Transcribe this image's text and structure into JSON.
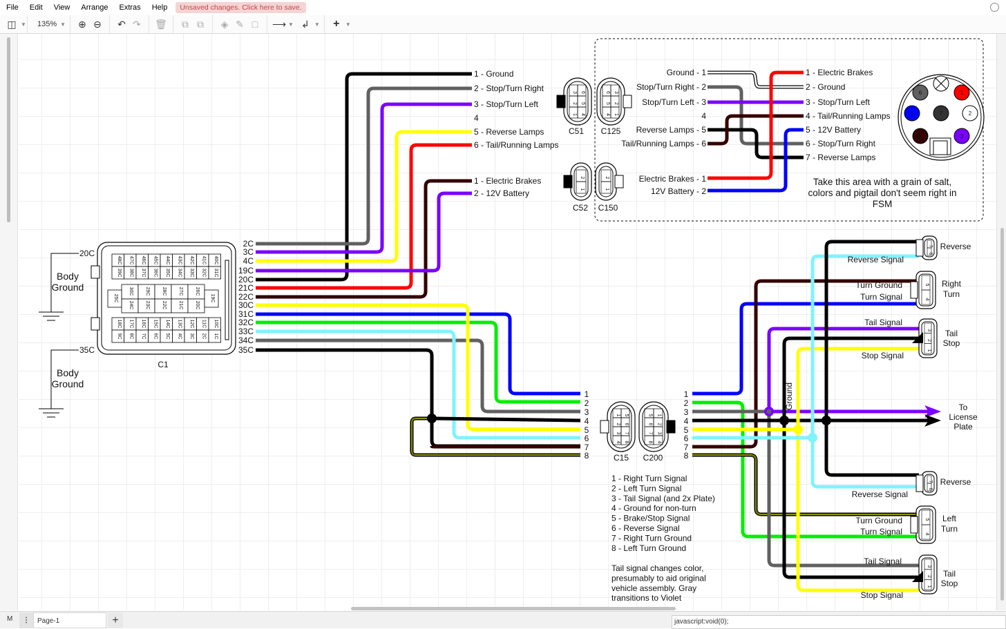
{
  "menu": {
    "items": [
      "File",
      "Edit",
      "View",
      "Arrange",
      "Extras",
      "Help"
    ],
    "unsaved": "Unsaved changes. Click here to save."
  },
  "toolbar": {
    "zoom": "135%"
  },
  "footer": {
    "mode": "M",
    "page_tab": "Page-1",
    "status": "javascript:void(0);"
  },
  "colors": {
    "black": "#000000",
    "gray": "#606060",
    "violet": "#7a00ff",
    "yellow": "#ffff00",
    "red": "#ff0000",
    "brown": "#330000",
    "blue": "#0000ff",
    "green": "#00ee00",
    "cyan": "#7ff3ff"
  },
  "c1": {
    "name": "C1",
    "row1": [
      "48C",
      "47C",
      "46C",
      "45C",
      "44C",
      "43C",
      "42C",
      "41C",
      "40C"
    ],
    "row2": [
      "39C",
      "38C",
      "37C",
      "36C",
      "35C",
      "34C",
      "33C",
      "32C",
      "31C"
    ],
    "mid_left": "25C",
    "mid_right": "19C",
    "row3": [
      "30C",
      "29C",
      "28C",
      "27C",
      "26C"
    ],
    "row4": [
      "24C",
      "23C",
      "22C",
      "21C",
      "20C"
    ],
    "row5": [
      "18C",
      "17C",
      "16C",
      "15C",
      "14C",
      "13C",
      "12C",
      "11C",
      "10C"
    ],
    "row6": [
      "9C",
      "8C",
      "7C",
      "6C",
      "5C",
      "4C",
      "3C",
      "2C",
      "1C"
    ],
    "pins": [
      "2C",
      "3C",
      "4C",
      "19C",
      "20C",
      "21C",
      "22C",
      "30C",
      "31C",
      "32C",
      "33C",
      "34C",
      "35C"
    ],
    "ground_20c": "20C",
    "ground_35c": "35C",
    "body_ground_1": [
      "Body",
      "Ground"
    ],
    "body_ground_2": [
      "Body",
      "Ground"
    ]
  },
  "c51_labels": [
    "1 - Ground",
    "2 - Stop/Turn Right",
    "3 - Stop/Turn Left",
    "4",
    "5 - Reverse Lamps",
    "6 - Tail/Running Lamps"
  ],
  "c52_labels": [
    "1 - Electric Brakes",
    "2 - 12V Battery"
  ],
  "connectors": {
    "c51": "C51",
    "c125": "C125",
    "c52": "C52",
    "c150": "C150",
    "c15": "C15",
    "c200": "C200"
  },
  "c125_left": [
    "Ground - 1",
    "Stop/Turn Right - 2",
    "Stop/Turn Left - 3",
    "4",
    "Reverse Lamps - 5",
    "Tail/Running Lamps - 6"
  ],
  "c150_left": [
    "Electric Brakes - 1",
    "12V Battery - 2"
  ],
  "pigtail_right": [
    "1 - Electric Brakes",
    "2 - Ground",
    "3 - Stop/Turn Left",
    "4 - Tail/Running Lamps",
    "5 - 12V Battery",
    "6 - Stop/Turn Right",
    "7 - Reverse Lamps"
  ],
  "pigtail_note": [
    "Take this area with a grain of salt,",
    "colors and pigtail don't seem right in",
    "FSM"
  ],
  "plug_pins": [
    "1",
    "2",
    "3",
    "4",
    "5",
    "6",
    "7"
  ],
  "c15_left_nums": [
    "1",
    "2",
    "3",
    "4",
    "5",
    "6",
    "7",
    "8"
  ],
  "c200_right_nums": [
    "1",
    "2",
    "3",
    "4",
    "5",
    "6",
    "7",
    "8"
  ],
  "legend": [
    "1 - Right Turn Signal",
    "2 - Left Turn Signal",
    "3 - Tail Signal (and 2x Plate)",
    "4 - Ground for non-turn",
    "5 - Brake/Stop Signal",
    "6 - Reverse Signal",
    "7 - Right Turn Ground",
    "8 - Left Turn Ground"
  ],
  "note": [
    "Tail signal changes color,",
    "presumably to aid original",
    "vehicle assembly.  Gray",
    "transitions to Violet"
  ],
  "ground_vertical": "Ground",
  "license": [
    "To",
    "License",
    "Plate"
  ],
  "lamps": {
    "reverse_top": "Reverse",
    "reverse_signal_top": "Reverse Signal",
    "right_turn": [
      "Right",
      "Turn"
    ],
    "turn_ground_r": "Turn Ground",
    "turn_signal_r": "Turn Signal",
    "tail_stop_r": [
      "Tail",
      "Stop"
    ],
    "tail_signal_r": "Tail Signal",
    "stop_signal_r": "Stop Signal",
    "reverse_bot": "Reverse",
    "reverse_signal_bot": "Reverse Signal",
    "left_turn": [
      "Left",
      "Turn"
    ],
    "turn_ground_l": "Turn Ground",
    "turn_signal_l": "Turn Signal",
    "tail_stop_l": [
      "Tail",
      "Stop"
    ],
    "tail_signal_l": "Tail Signal",
    "stop_signal_l": "Stop Signal",
    "pins_rev": [
      "7",
      "6"
    ],
    "pins_turn": [
      "5",
      "4"
    ],
    "pins_tail": [
      "3",
      "2",
      "1"
    ]
  }
}
